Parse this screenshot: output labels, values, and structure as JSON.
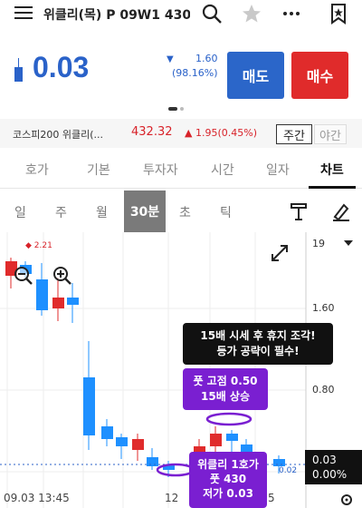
{
  "header": {
    "title": "위클리(목) P 09W1 430.0",
    "icons": [
      "menu-icon",
      "search-icon",
      "star-icon",
      "more-icon",
      "bookmark-icon"
    ]
  },
  "quote": {
    "price": "0.03",
    "change_arrow": "▼",
    "change": "1.60",
    "change_pct": "(98.16%)",
    "sell_label": "매도",
    "buy_label": "매수",
    "colors": {
      "down": "#2a62c9",
      "up": "#e02b2b"
    }
  },
  "index_bar": {
    "name": "코스피200 위클리(...",
    "price": "432.32",
    "change_arrow": "▲",
    "change": "1.95(0.45%)",
    "day_label": "주간",
    "night_label": "야간"
  },
  "tabs": [
    {
      "label": "호가"
    },
    {
      "label": "기본"
    },
    {
      "label": "투자자"
    },
    {
      "label": "시간"
    },
    {
      "label": "일자"
    },
    {
      "label": "차트",
      "active": true
    }
  ],
  "periods": [
    {
      "label": "일"
    },
    {
      "label": "주"
    },
    {
      "label": "월"
    },
    {
      "label": "30분",
      "active": true
    },
    {
      "label": "초"
    },
    {
      "label": "틱"
    }
  ],
  "chart": {
    "y_top_label": "19",
    "y_labels": [
      "1.60",
      "0.80"
    ],
    "current_price": "0.03",
    "current_pct": "0.00%",
    "high_marker": "2.21",
    "low_marker": "0.02",
    "x_labels": [
      "09.03 13:45",
      "12",
      "5"
    ],
    "candle_colors": {
      "up": "#e02b2b",
      "down": "#1e90ff"
    }
  },
  "annotations": {
    "black_line1": "15배 시세 후 휴지 조각!",
    "black_line2": "등가 공략이 필수!",
    "purple1_line1": "풋 고점 0.50",
    "purple1_line2": "15배 상승",
    "purple2_line1": "위클리 1호가",
    "purple2_line2": "풋 430",
    "purple2_line3": "저가 0.03"
  }
}
